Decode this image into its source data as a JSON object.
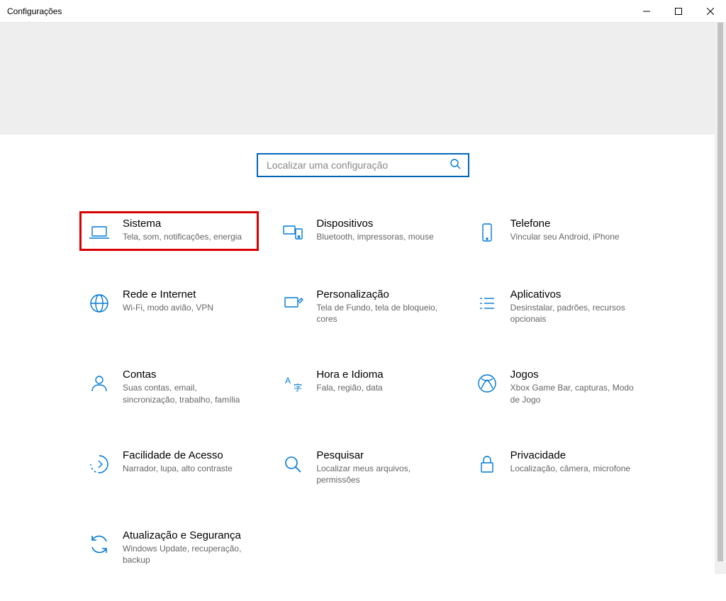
{
  "window": {
    "title": "Configurações"
  },
  "search": {
    "placeholder": "Localizar uma configuração"
  },
  "categories": [
    {
      "id": "system",
      "title": "Sistema",
      "desc": "Tela, som, notificações, energia"
    },
    {
      "id": "devices",
      "title": "Dispositivos",
      "desc": "Bluetooth, impressoras, mouse"
    },
    {
      "id": "phone",
      "title": "Telefone",
      "desc": "Vincular seu Android, iPhone"
    },
    {
      "id": "network",
      "title": "Rede e Internet",
      "desc": "Wi-Fi, modo avião, VPN"
    },
    {
      "id": "personalize",
      "title": "Personalização",
      "desc": "Tela de Fundo, tela de bloqueio, cores"
    },
    {
      "id": "apps",
      "title": "Aplicativos",
      "desc": "Desinstalar, padrões, recursos opcionais"
    },
    {
      "id": "accounts",
      "title": "Contas",
      "desc": "Suas contas, email, sincronização, trabalho, família"
    },
    {
      "id": "time",
      "title": "Hora e Idioma",
      "desc": "Fala, região, data"
    },
    {
      "id": "gaming",
      "title": "Jogos",
      "desc": "Xbox Game Bar, capturas, Modo de Jogo"
    },
    {
      "id": "ease",
      "title": "Facilidade de Acesso",
      "desc": "Narrador, lupa, alto contraste"
    },
    {
      "id": "search",
      "title": "Pesquisar",
      "desc": "Localizar meus arquivos, permissões"
    },
    {
      "id": "privacy",
      "title": "Privacidade",
      "desc": "Localização, câmera, microfone"
    },
    {
      "id": "update",
      "title": "Atualização e Segurança",
      "desc": "Windows Update, recuperação, backup"
    }
  ]
}
